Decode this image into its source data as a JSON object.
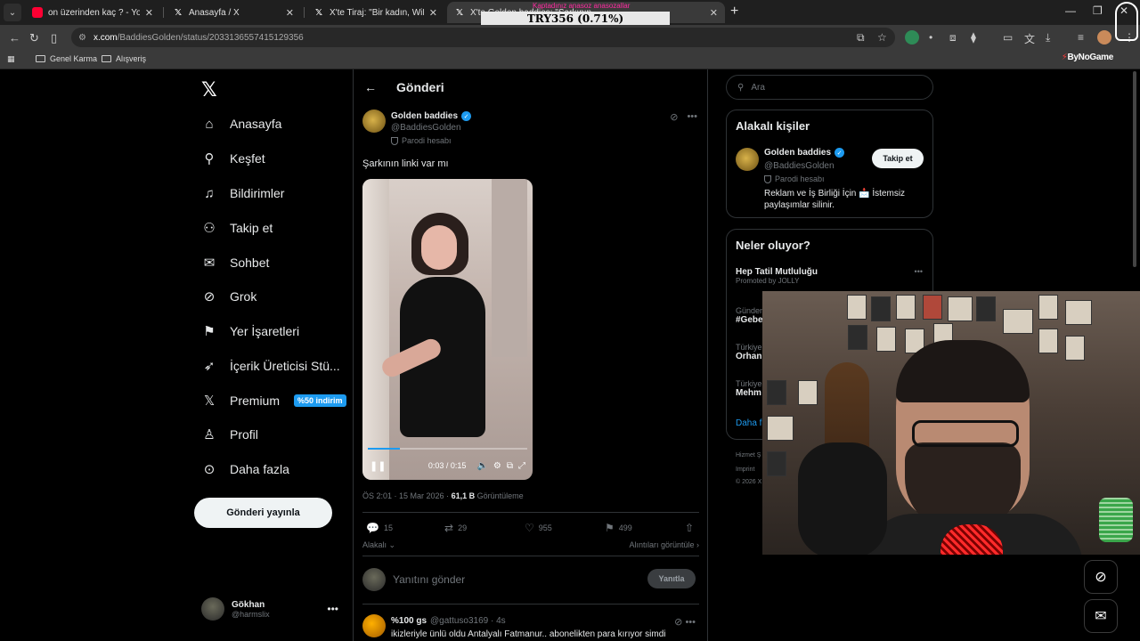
{
  "browser": {
    "tabs": [
      {
        "title": "on üzerinden kaç ? - YouTube",
        "icon": "youtube-icon"
      },
      {
        "title": "Anasayfa / X",
        "icon": "x-icon"
      },
      {
        "title": "X'te Tiraj: \"Bir kadın, WiFi kutus...",
        "icon": "x-icon"
      },
      {
        "title": "X'te Golden baddies: \"Şarkının...",
        "icon": "x-icon",
        "active": true
      }
    ],
    "ticker": "TRY356 (0.71%)",
    "ticker_top": "Kaptadınız   anasoz   anasozallar",
    "url_host": "x.com",
    "url_path": "/BaddiesGolden/status/2033136557415129356",
    "bookmarks": [
      "Genel Karma",
      "Alışveriş"
    ],
    "brand": "ByNoGame"
  },
  "nav": {
    "items": [
      {
        "label": "Anasayfa",
        "icon": "home-icon"
      },
      {
        "label": "Keşfet",
        "icon": "search-icon"
      },
      {
        "label": "Bildirimler",
        "icon": "bell-icon"
      },
      {
        "label": "Takip et",
        "icon": "add-user-icon"
      },
      {
        "label": "Sohbet",
        "icon": "mail-icon"
      },
      {
        "label": "Grok",
        "icon": "grok-icon"
      },
      {
        "label": "Yer İşaretleri",
        "icon": "bookmark-icon"
      },
      {
        "label": "İçerik Üreticisi Stü...",
        "icon": "rocket-icon"
      },
      {
        "label": "Premium",
        "icon": "x-icon"
      },
      {
        "label": "Profil",
        "icon": "profile-icon"
      },
      {
        "label": "Daha fazla",
        "icon": "more-circle-icon"
      }
    ],
    "premium_badge": "%50 indirim",
    "post_button": "Gönderi yayınla",
    "user": {
      "name": "Gökhan",
      "handle": "@harmslix"
    }
  },
  "post": {
    "header": "Gönderi",
    "author_name": "Golden baddies",
    "author_handle": "@BaddiesGolden",
    "parody_label": "Parodi hesabı",
    "text": "Şarkının linki var mı",
    "video_time": "0:03 / 0:15",
    "video_progress": 0.2,
    "timestamp": "ÖS 2:01 · 15 Mar 2026 · ",
    "views": "61,1 B",
    "views_label": " Görüntüleme",
    "replies": "15",
    "reposts": "29",
    "likes": "955",
    "bookmarks": "499",
    "related_label": "Alakalı",
    "quotes_label": "Alıntıları görüntüle",
    "reply_placeholder": "Yanıtını gönder",
    "reply_button": "Yanıtla"
  },
  "next_post": {
    "name": "%100 gs",
    "handle": "@gattuso3169 · 4s",
    "text": "ikizleriyle ünlü oldu Antalyalı Fatmanur.. abonelikten para kırıyor simdi"
  },
  "sidebar": {
    "search_placeholder": "Ara",
    "related_title": "Alakalı kişiler",
    "rp_name": "Golden baddies",
    "rp_handle": "@BaddiesGolden",
    "rp_parody": "Parodi hesabı",
    "rp_bio": "Reklam ve İş Birliği İçin 📩 İstemsiz paylaşımlar silinir.",
    "follow_button": "Takip et",
    "trends_title": "Neler oluyor?",
    "trends": [
      {
        "t1": "",
        "t2": "Hep Tatil Mutluluğu",
        "t3": "Promoted by JOLLY"
      },
      {
        "t1": "Gündem",
        "t2": "#Gebe",
        "t3": ""
      },
      {
        "t1": "Türkiye",
        "t2": "Orhan",
        "t3": ""
      },
      {
        "t1": "Türkiye",
        "t2": "Mehm",
        "t3": ""
      }
    ],
    "more_link": "Daha f",
    "footer": [
      "Hizmet Ş",
      "Imprint",
      "© 2026 X"
    ]
  },
  "colors": {
    "accent": "#1d9bf0",
    "background": "#000000",
    "border": "#2f3336"
  }
}
